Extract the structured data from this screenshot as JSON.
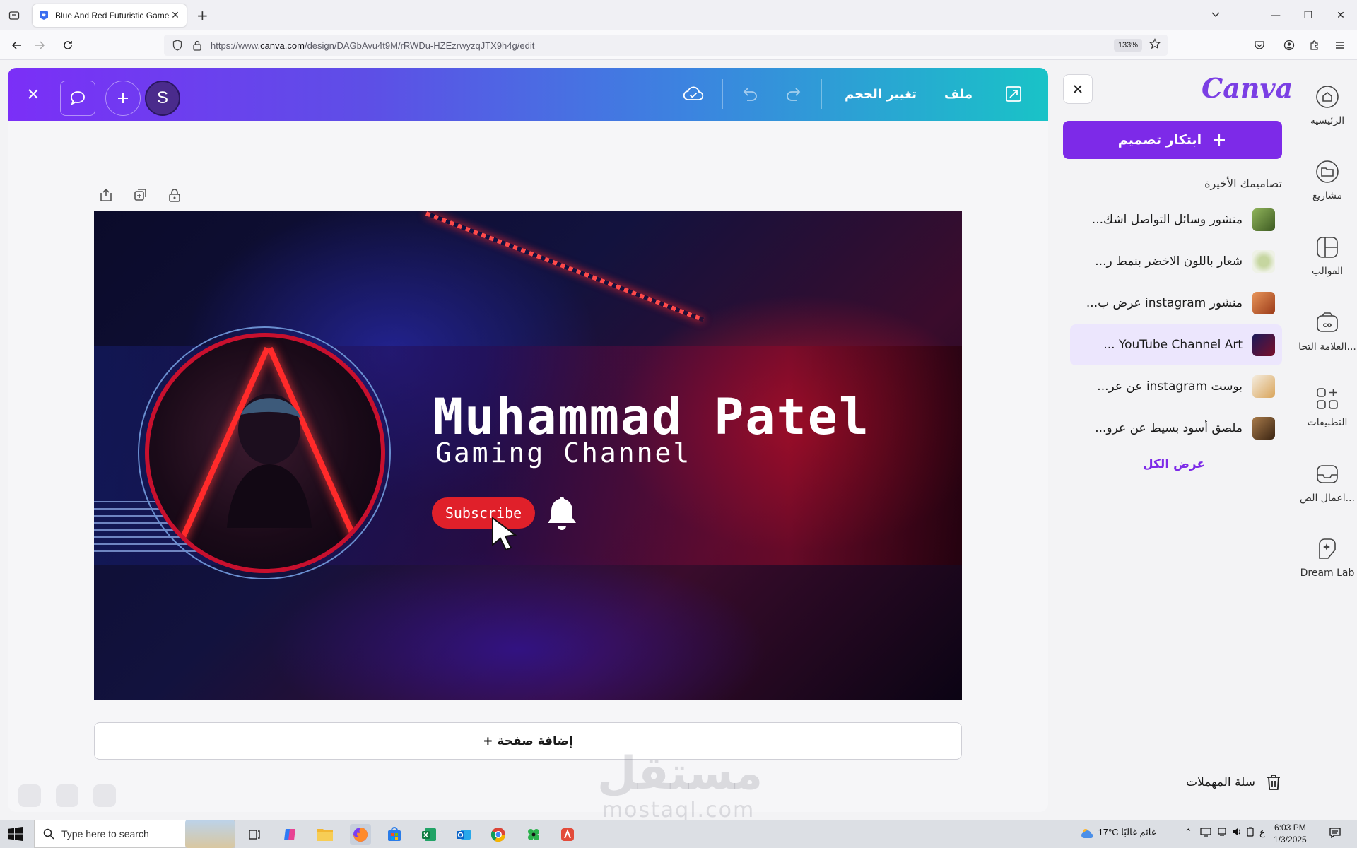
{
  "browser": {
    "tab_title": "Blue And Red Futuristic Game Y",
    "url_prefix": "https://www.",
    "url_host": "canva.com",
    "url_path": "/design/DAGbAvu4t9M/rRWDu-HZEzrwyzqJTX9h4g/edit",
    "zoom": "133%"
  },
  "topbar": {
    "file_label": "ملف",
    "resize_label": "تغيير الحجم",
    "avatar_initial": "S"
  },
  "design": {
    "name": "Muhammad Patel",
    "subtitle": "Gaming Channel",
    "subscribe": "Subscribe"
  },
  "add_page_label": "+ إضافة صفحة",
  "panel": {
    "logo": "Canva",
    "create_label": "ابتكار تصميم",
    "recent_title": "تصاميمك الأخيرة",
    "recent": [
      {
        "title": "منشور وسائل التواصل اشك...",
        "thumb": "#6b8f3a"
      },
      {
        "title": "شعار باللون الاخضر بنمط ر...",
        "thumb": "#dfe6cf"
      },
      {
        "title": "منشور instagram عرض ب...",
        "thumb": "#c8612a"
      },
      {
        "title": "YouTube Channel Art ...",
        "thumb": "#2a0f55"
      },
      {
        "title": "بوست instagram عن عر...",
        "thumb": "#e9dcc8"
      },
      {
        "title": "ملصق أسود بسيط عن عرو...",
        "thumb": "#6a4a2a"
      }
    ],
    "view_all": "عرض الكل",
    "trash": "سلة المهملات"
  },
  "rail": [
    {
      "label": "الرئيسية",
      "icon": "home-icon"
    },
    {
      "label": "مشاريع",
      "icon": "folder-icon"
    },
    {
      "label": "القوالب",
      "icon": "templates-icon"
    },
    {
      "label": "العلامة التجا...",
      "icon": "brand-icon"
    },
    {
      "label": "التطبيقات",
      "icon": "apps-icon"
    },
    {
      "label": "أعمال الص...",
      "icon": "inbox-icon"
    },
    {
      "label": "Dream Lab",
      "icon": "dream-lab-icon"
    }
  ],
  "watermark": {
    "ar": "مستقل",
    "en": "mostaql.com"
  },
  "taskbar": {
    "search_placeholder": "Type here to search",
    "temp": "17°C",
    "weather": "غائم غالبًا",
    "lang": "ع",
    "time": "6:03 PM",
    "date": "1/3/2025"
  },
  "colors": {
    "accent": "#7d2ae8",
    "subscribe": "#e0202a"
  }
}
